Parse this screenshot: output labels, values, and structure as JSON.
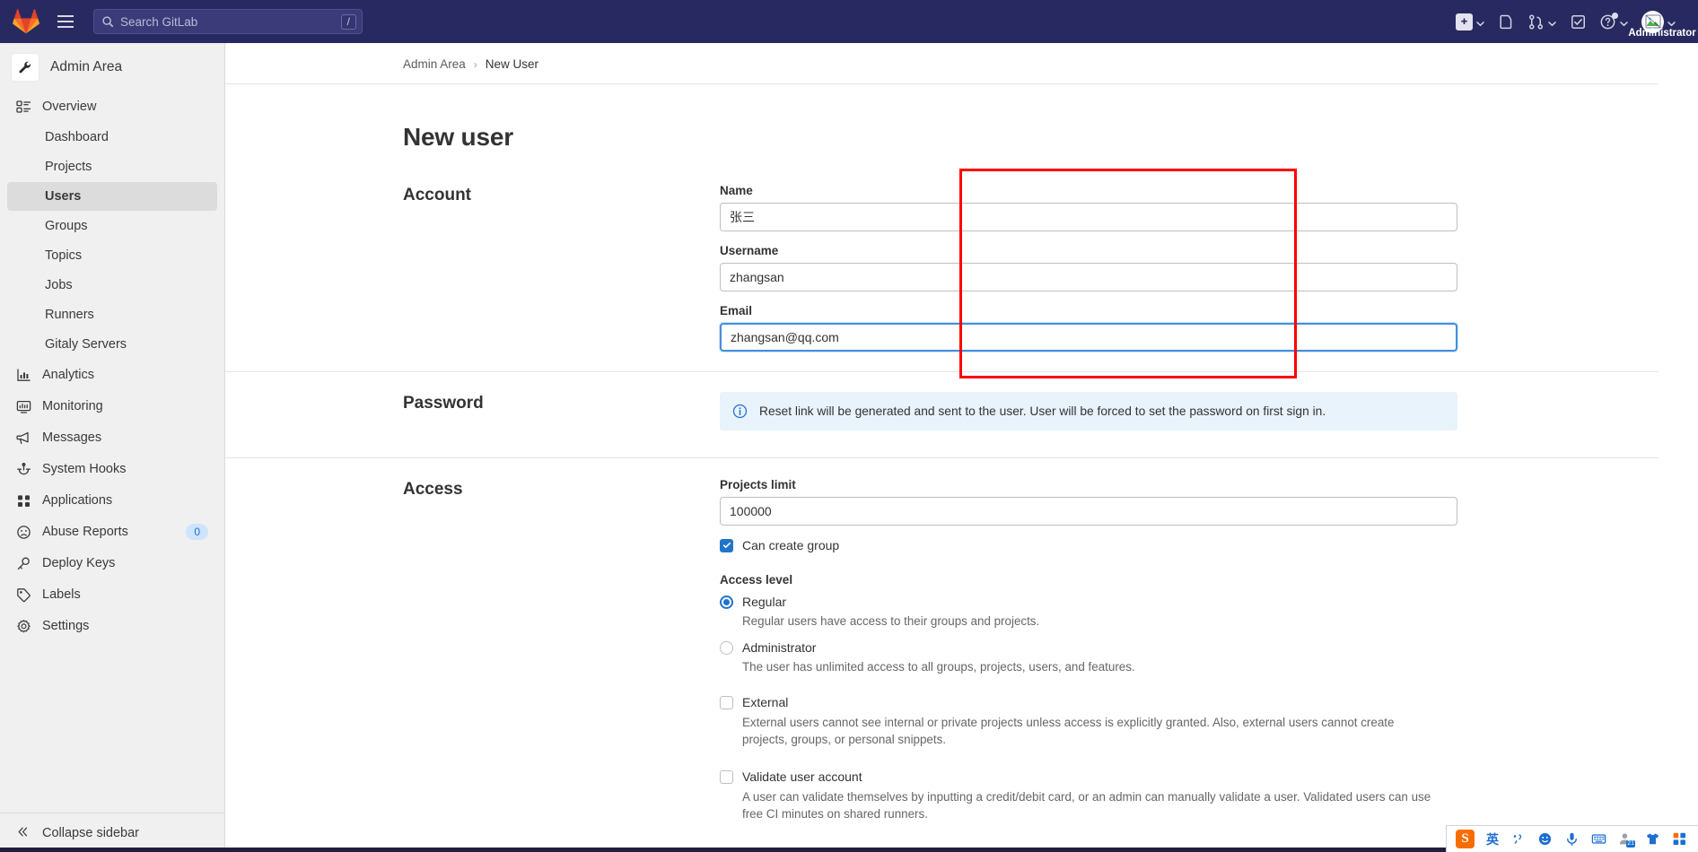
{
  "topbar": {
    "logo_icon": "gitlab-logo-icon",
    "menu_icon": "hamburger-menu-icon",
    "search": {
      "placeholder": "Search GitLab",
      "icon": "search-icon",
      "shortcut_key": "/"
    },
    "actions": [
      {
        "name": "create-new-menu",
        "icon": "plus-square-icon",
        "has_chevron": true
      },
      {
        "name": "issues-link",
        "icon": "issues-document-icon",
        "has_chevron": false
      },
      {
        "name": "merge-requests-menu",
        "icon": "merge-request-icon",
        "has_chevron": true
      },
      {
        "name": "todos-link",
        "icon": "todo-checkbox-icon",
        "has_chevron": false
      },
      {
        "name": "help-menu",
        "icon": "help-circle-icon",
        "has_chevron": true
      }
    ],
    "user": {
      "label": "Administrator",
      "avatar_icon": "broken-image-avatar-icon",
      "has_chevron": true
    }
  },
  "sidebar": {
    "context_title": "Admin Area",
    "context_icon": "wrench-icon",
    "collapse_label": "Collapse sidebar",
    "collapse_icon": "double-chevron-left-icon",
    "items": [
      {
        "label": "Overview",
        "icon": "overview-grid-icon",
        "type": "parent",
        "children": [
          {
            "label": "Dashboard",
            "active": false
          },
          {
            "label": "Projects",
            "active": false
          },
          {
            "label": "Users",
            "active": true
          },
          {
            "label": "Groups",
            "active": false
          },
          {
            "label": "Topics",
            "active": false
          },
          {
            "label": "Jobs",
            "active": false
          },
          {
            "label": "Runners",
            "active": false
          },
          {
            "label": "Gitaly Servers",
            "active": false
          }
        ]
      },
      {
        "label": "Analytics",
        "icon": "analytics-chart-icon",
        "type": "item"
      },
      {
        "label": "Monitoring",
        "icon": "monitor-icon",
        "type": "item"
      },
      {
        "label": "Messages",
        "icon": "megaphone-icon",
        "type": "item"
      },
      {
        "label": "System Hooks",
        "icon": "hook-icon",
        "type": "item"
      },
      {
        "label": "Applications",
        "icon": "applications-grid-icon",
        "type": "item"
      },
      {
        "label": "Abuse Reports",
        "icon": "abuse-face-icon",
        "type": "item",
        "badge": "0"
      },
      {
        "label": "Deploy Keys",
        "icon": "key-icon",
        "type": "item"
      },
      {
        "label": "Labels",
        "icon": "label-tag-icon",
        "type": "item"
      },
      {
        "label": "Settings",
        "icon": "gear-icon",
        "type": "item"
      }
    ]
  },
  "main": {
    "breadcrumb": {
      "root": "Admin Area",
      "separator": "›",
      "current": "New User"
    },
    "page_title": "New user",
    "sections": {
      "account": {
        "title": "Account",
        "fields": {
          "name": {
            "label": "Name",
            "value": "张三",
            "focused": false
          },
          "username": {
            "label": "Username",
            "value": "zhangsan",
            "focused": false
          },
          "email": {
            "label": "Email",
            "value": "zhangsan@qq.com",
            "focused": true
          }
        }
      },
      "password": {
        "title": "Password",
        "alert_icon": "info-circle-icon",
        "alert_text": "Reset link will be generated and sent to the user. User will be forced to set the password on first sign in."
      },
      "access": {
        "title": "Access",
        "projects_limit": {
          "label": "Projects limit",
          "value": "100000"
        },
        "can_create_group": {
          "label": "Can create group",
          "checked": true
        },
        "access_level_label": "Access level",
        "access_levels": [
          {
            "label": "Regular",
            "selected": true,
            "hint": "Regular users have access to their groups and projects."
          },
          {
            "label": "Administrator",
            "selected": false,
            "hint": "The user has unlimited access to all groups, projects, users, and features."
          }
        ],
        "external": {
          "label": "External",
          "checked": false,
          "hint": "External users cannot see internal or private projects unless access is explicitly granted. Also, external users cannot create projects, groups, or personal snippets."
        },
        "validate_user": {
          "label": "Validate user account",
          "checked": false,
          "hint": "A user can validate themselves by inputting a credit/debit card, or an admin can manually validate a user. Validated users can use free CI minutes on shared runners."
        }
      }
    }
  },
  "annotation": {
    "highlight_color": "#ff0000",
    "target": "account-fields-group"
  },
  "ime": {
    "logo_text": "S",
    "mode_label": "英",
    "tools": [
      {
        "name": "punctuation-toggle-icon"
      },
      {
        "name": "emoji-icon"
      },
      {
        "name": "microphone-icon"
      },
      {
        "name": "soft-keyboard-icon"
      },
      {
        "name": "user-account-icon",
        "badge": "21"
      },
      {
        "name": "skin-shirt-icon"
      },
      {
        "name": "app-grid-icon"
      }
    ]
  }
}
